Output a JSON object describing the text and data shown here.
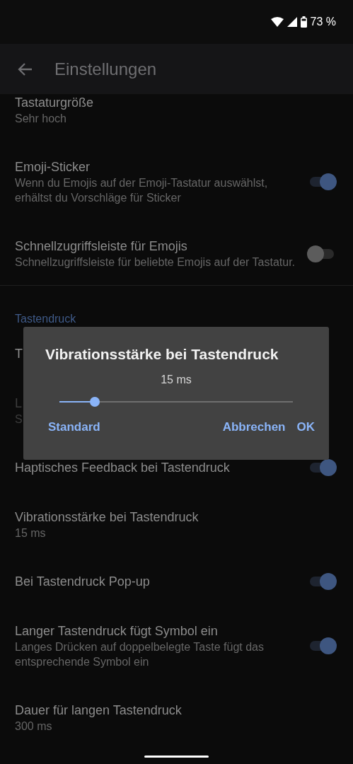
{
  "status_bar": {
    "battery_text": "73 %"
  },
  "app_bar": {
    "title": "Einstellungen"
  },
  "settings": [
    {
      "kind": "item",
      "title": "Tastaturgröße",
      "summary": "Sehr hoch",
      "disabled": false
    },
    {
      "kind": "item",
      "title": "Emoji-Sticker",
      "summary": "Wenn du Emojis auf der Emoji-Tastatur auswählst, erhältst du Vorschläge für Sticker",
      "disabled": false,
      "on": true
    },
    {
      "kind": "item",
      "title": "Schnellzugriffsleiste für Emojis",
      "summary": "Schnellzugriffsleiste für beliebte Emojis auf der Tastatur.",
      "disabled": false,
      "on": false
    },
    {
      "kind": "divider"
    },
    {
      "kind": "header",
      "title": "Tastendruck"
    },
    {
      "kind": "item",
      "title": "T",
      "disabled": false
    },
    {
      "kind": "item",
      "title": "L",
      "summary": "S",
      "disabled": true
    },
    {
      "kind": "item",
      "title": "Haptisches Feedback bei Tastendruck",
      "disabled": false,
      "on": true
    },
    {
      "kind": "item",
      "title": "Vibrationsstärke bei Tastendruck",
      "summary": "15 ms",
      "disabled": false
    },
    {
      "kind": "item",
      "title": "Bei Tastendruck Pop-up",
      "disabled": false,
      "on": true
    },
    {
      "kind": "item",
      "title": "Langer Tastendruck fügt Symbol ein",
      "summary": "Langes Drücken auf doppelbelegte Taste fügt das entsprechende Symbol ein",
      "disabled": false,
      "on": true
    },
    {
      "kind": "item",
      "title": "Dauer für langen Tastendruck",
      "summary": "300 ms",
      "disabled": false
    }
  ],
  "dialog": {
    "title": "Vibrationsstärke bei Tastendruck",
    "value": "15 ms",
    "level": 0.15,
    "buttons": [
      {
        "label": "Standard"
      },
      {
        "label": "Abbrechen"
      },
      {
        "label": "OK"
      }
    ]
  }
}
